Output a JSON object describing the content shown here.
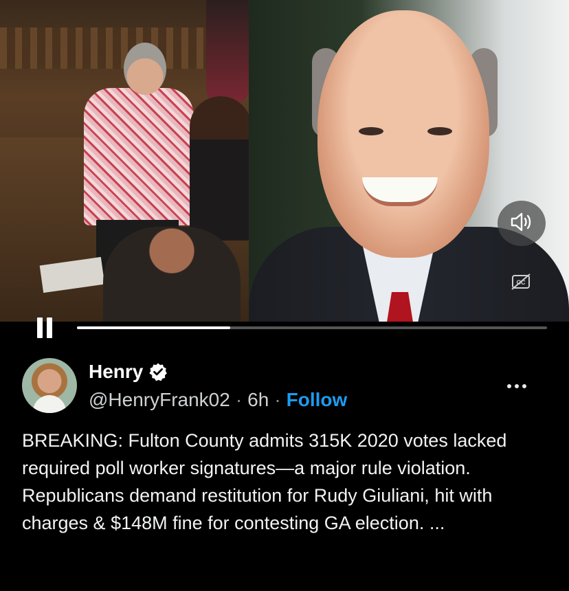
{
  "video": {
    "controls": {
      "volume_icon": "speaker-sound-icon",
      "captions_icon": "closed-captions-icon",
      "play_state_icon": "pause-icon",
      "progress_fraction": 0.326
    }
  },
  "tweet": {
    "author": {
      "display_name": "Henry",
      "verified_icon": "verified-badge-icon",
      "handle": "@HenryFrank02",
      "separator": "·",
      "time_ago": "6h",
      "follow_label": "Follow"
    },
    "more_icon": "more-options-icon",
    "text": "BREAKING: Fulton County admits 315K 2020 votes lacked required poll worker signatures—a major rule violation. Republicans demand restitution for Rudy Giuliani, hit with charges & $148M fine for contesting GA election. ..."
  },
  "colors": {
    "background": "#000000",
    "link_blue": "#1d9bf0",
    "text_primary": "#e7e9ea"
  }
}
